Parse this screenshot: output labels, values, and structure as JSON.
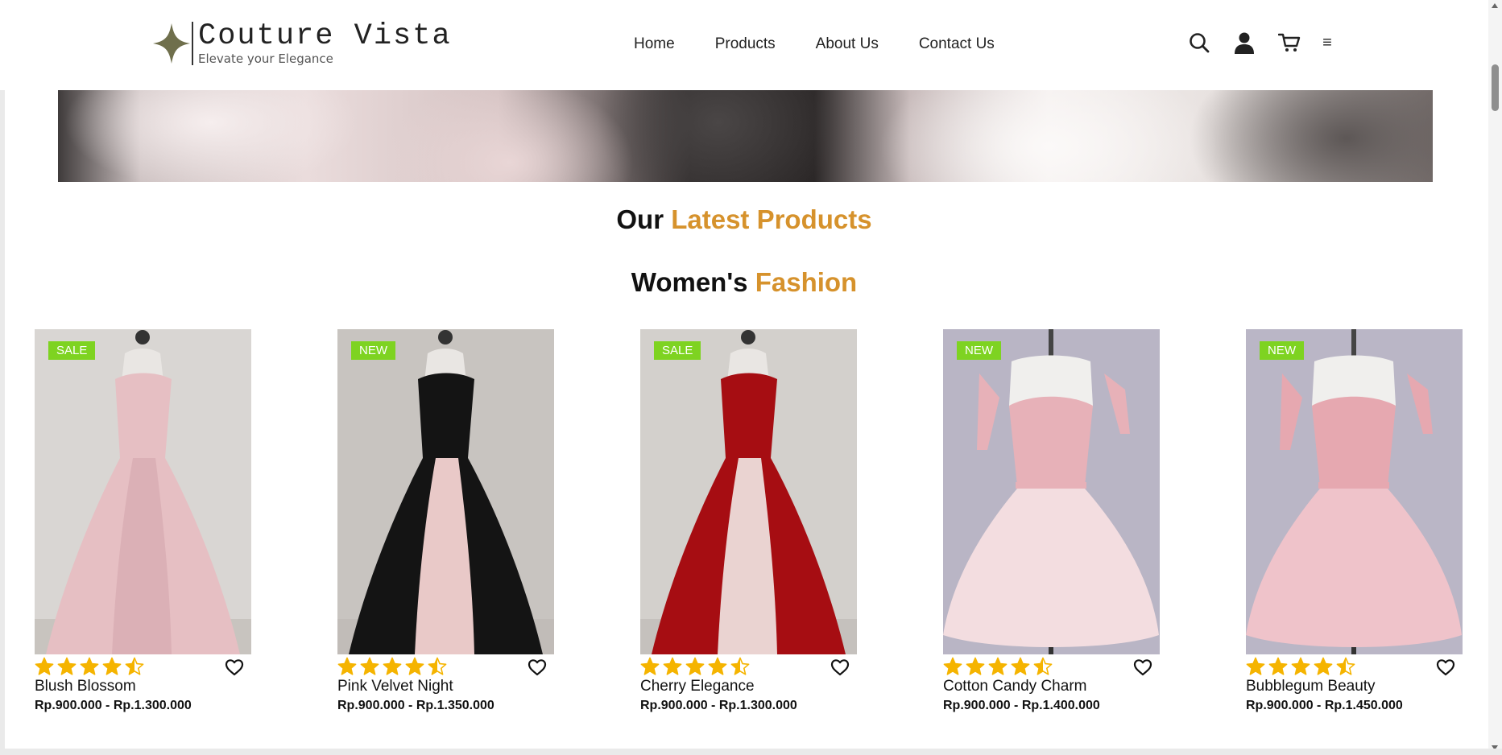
{
  "brand": {
    "name": "Couture Vista",
    "tagline": "Elevate your Elegance",
    "logo_color": "#6f6f4c"
  },
  "nav": {
    "items": [
      {
        "label": "Home"
      },
      {
        "label": "Products"
      },
      {
        "label": "About Us"
      },
      {
        "label": "Contact Us"
      }
    ]
  },
  "header_icons": [
    "search-icon",
    "user-icon",
    "cart-icon",
    "menu-icon"
  ],
  "menu_glyph": "≡",
  "sections": {
    "latest": {
      "prefix": "Our ",
      "accent": "Latest Products"
    },
    "women": {
      "prefix": "Women's ",
      "accent": "Fashion"
    },
    "accent_color": "#d6922c"
  },
  "badge_color": "#7ed321",
  "star_color": "#f5b400",
  "products": [
    {
      "name": "Blush Blossom",
      "price": "Rp.900.000 - Rp.1.300.000",
      "badge": "SALE",
      "rating": 4.5,
      "dress_color": "#e6bfc3",
      "skirt_color": "#dbb0b6",
      "bg_color": "#d9d6d3"
    },
    {
      "name": "Pink Velvet Night",
      "price": "Rp.900.000 - Rp.1.350.000",
      "badge": "NEW",
      "rating": 4.5,
      "dress_color": "#141414",
      "skirt_color": "#e9c9c8",
      "bg_color": "#c8c4c0"
    },
    {
      "name": "Cherry Elegance",
      "price": "Rp.900.000 - Rp.1.300.000",
      "badge": "SALE",
      "rating": 4.5,
      "dress_color": "#a60d12",
      "skirt_color": "#ead3d1",
      "bg_color": "#d3d0cc"
    },
    {
      "name": "Cotton Candy Charm",
      "price": "Rp.900.000 - Rp.1.400.000",
      "badge": "NEW",
      "rating": 4.5,
      "dress_color": "#e7b1b8",
      "skirt_color": "#f3dde0",
      "bg_color": "#b9b5c5"
    },
    {
      "name": "Bubblegum Beauty",
      "price": "Rp.900.000 - Rp.1.450.000",
      "badge": "NEW",
      "rating": 4.5,
      "dress_color": "#e6a8b0",
      "skirt_color": "#efc3ca",
      "bg_color": "#bab6c6"
    }
  ]
}
